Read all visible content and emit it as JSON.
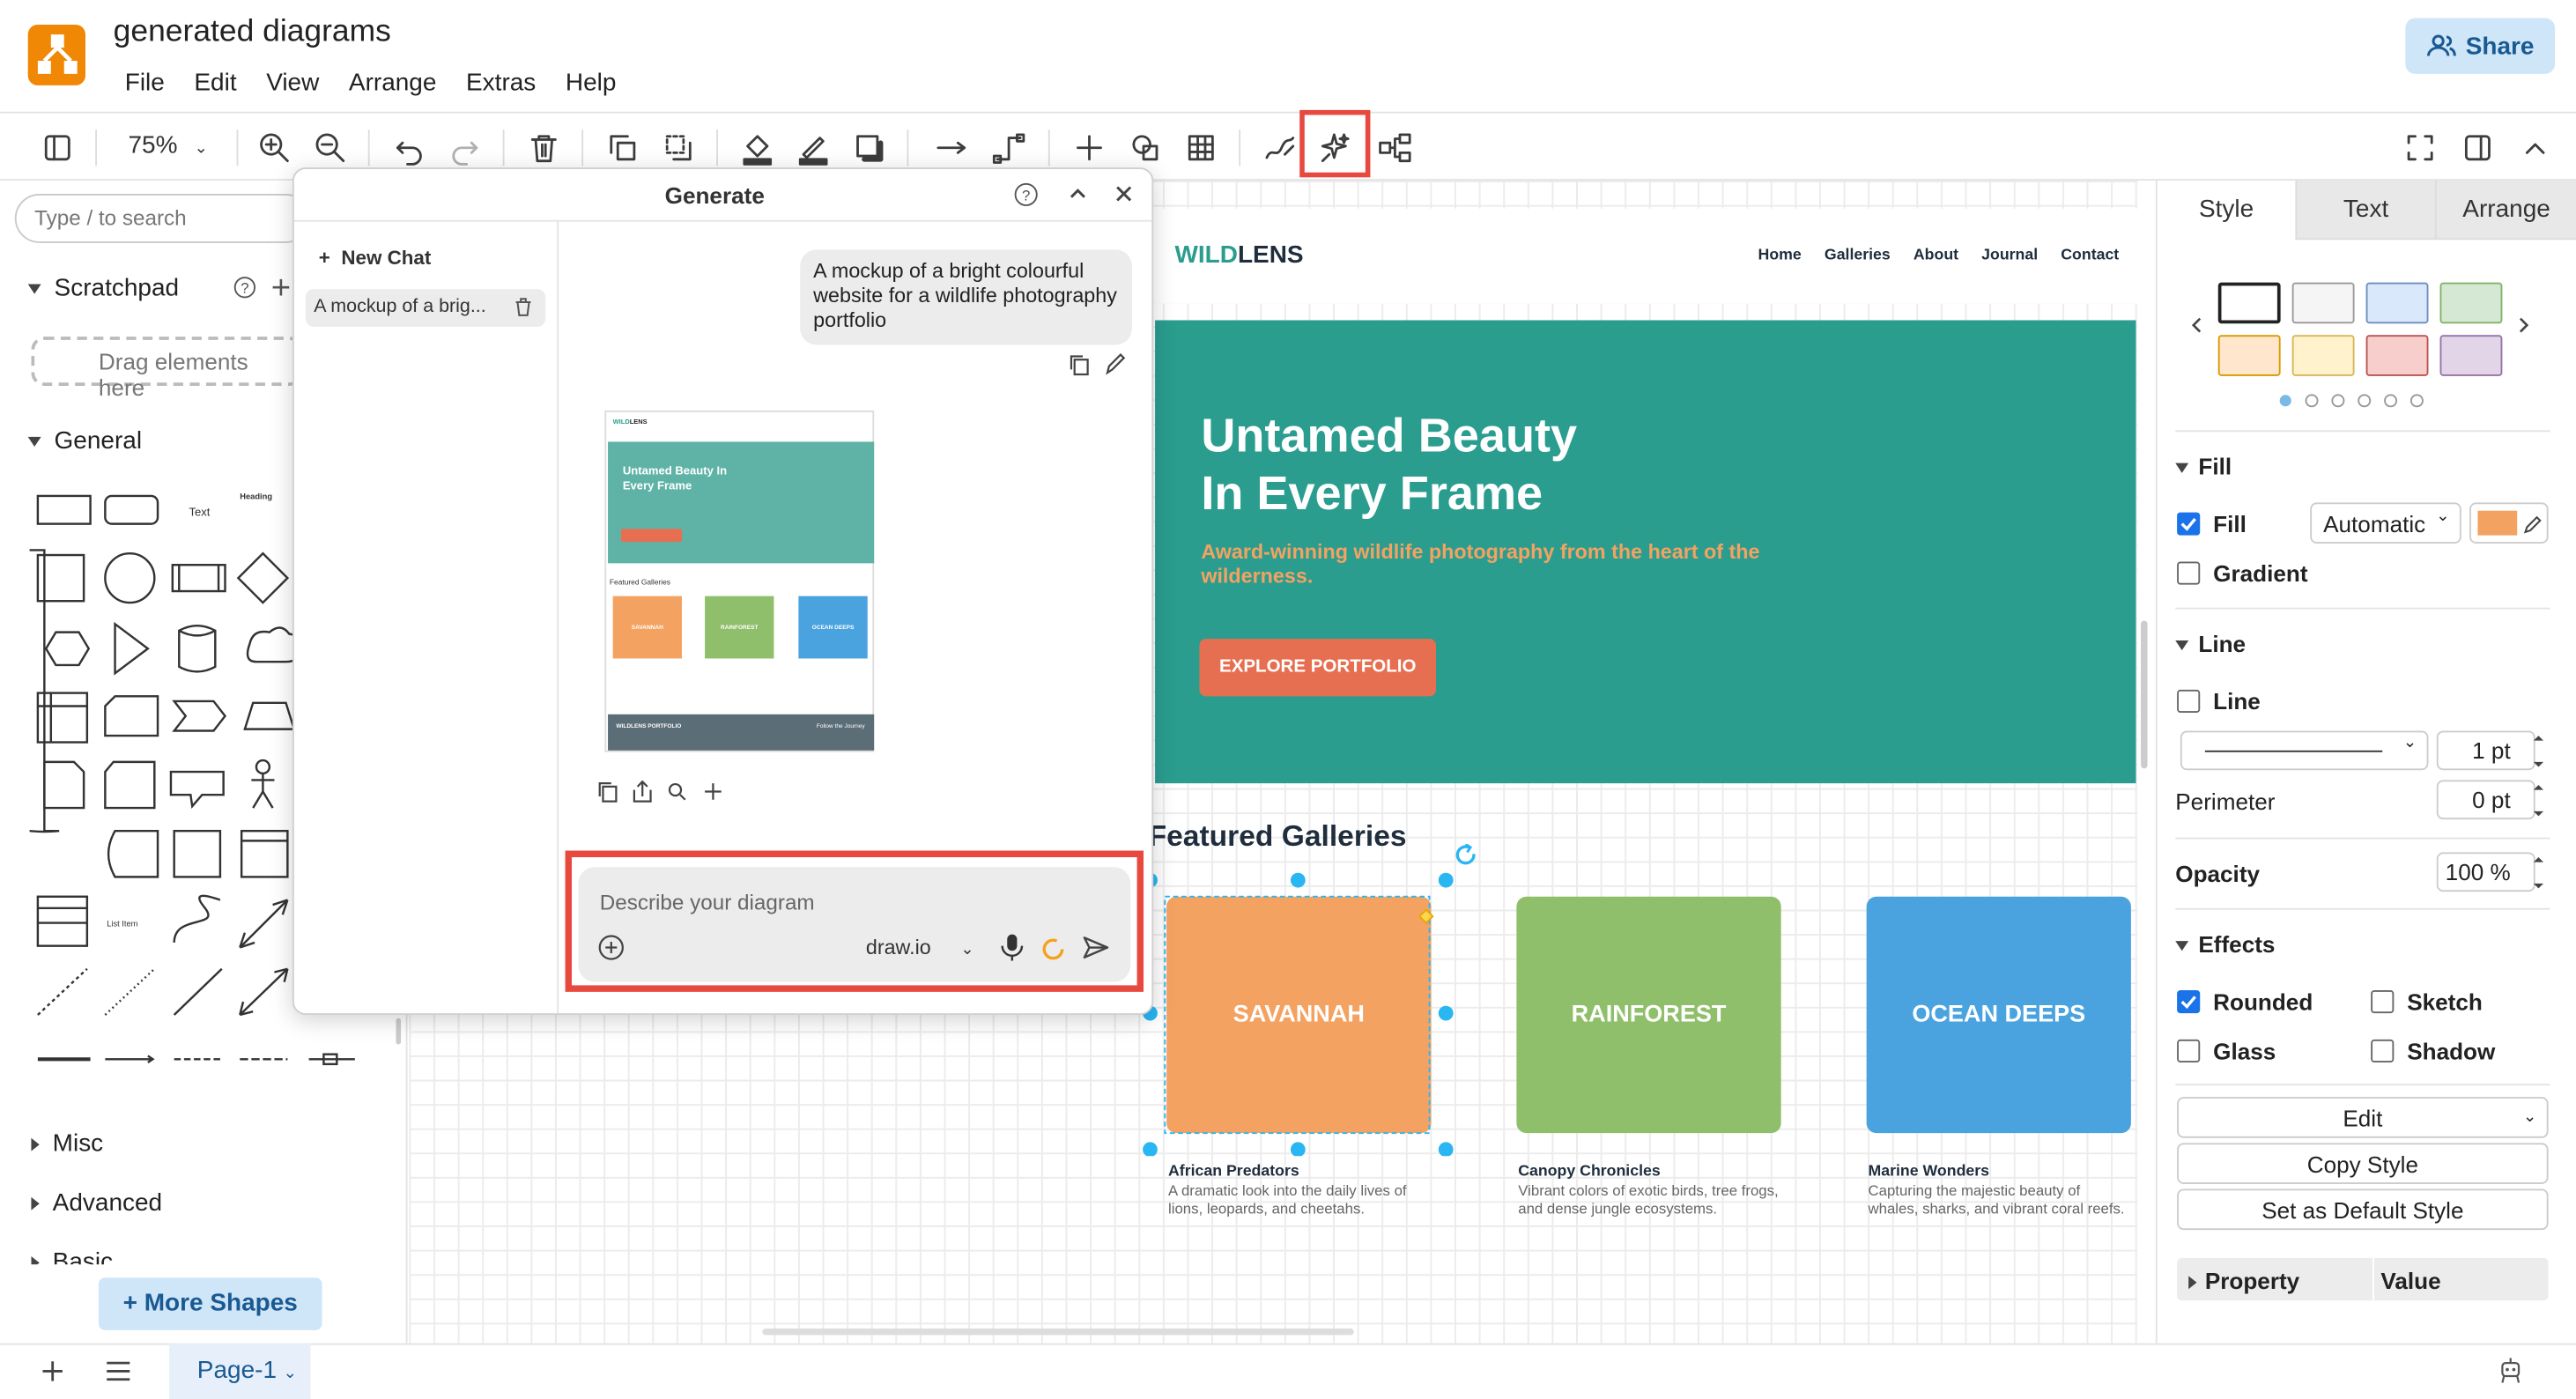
{
  "app": {
    "title": "generated diagrams",
    "menu": [
      "File",
      "Edit",
      "View",
      "Arrange",
      "Extras",
      "Help"
    ],
    "share_label": "Share"
  },
  "toolbar": {
    "zoom": "75%"
  },
  "left": {
    "search_placeholder": "Type / to search",
    "scratchpad": "Scratchpad",
    "drag_hint": "Drag elements here",
    "general": "General",
    "text_shape": "Text",
    "heading_shape": "Heading",
    "list_item_shape": "List Item",
    "misc": "Misc",
    "advanced": "Advanced",
    "basic": "Basic",
    "more_shapes": "More Shapes"
  },
  "generate": {
    "title": "Generate",
    "new_chat": "New Chat",
    "history": [
      "A mockup of a brig..."
    ],
    "user_message": "A mockup of a bright colourful website for a wildlife photography portfolio",
    "input_placeholder": "Describe your diagram",
    "model": "draw.io",
    "thumb": {
      "brand_a": "WILD",
      "brand_b": "LENS",
      "hero": "Untamed Beauty In Every Frame",
      "galleries": "Featured Galleries",
      "card_a": "SAVANNAH",
      "card_b": "RAINFOREST",
      "card_c": "OCEAN DEEPS",
      "footer": "WILDLENS PORTFOLIO",
      "footer_right": "Follow the Journey"
    }
  },
  "site": {
    "brand_a": "WILD",
    "brand_b": "LENS",
    "nav": [
      "Home",
      "Galleries",
      "About",
      "Journal",
      "Contact"
    ],
    "hero_line1": "Untamed Beauty",
    "hero_line2": "In Every Frame",
    "hero_sub": "Award-winning wildlife photography from the heart of the wilderness.",
    "cta": "EXPLORE PORTFOLIO",
    "galleries_heading": "Featured Galleries",
    "cards": [
      {
        "name": "SAVANNAH",
        "title": "African Predators",
        "desc": "A dramatic look into the daily lives of lions, leopards, and cheetahs.",
        "color": "#f4a261"
      },
      {
        "name": "RAINFOREST",
        "title": "Canopy Chronicles",
        "desc": "Vibrant colors of exotic birds, tree frogs, and dense jungle ecosystems.",
        "color": "#8fbf6a"
      },
      {
        "name": "OCEAN DEEPS",
        "title": "Marine Wonders",
        "desc": "Capturing the majestic beauty of whales, sharks, and vibrant coral reefs.",
        "color": "#4aa3df"
      }
    ],
    "colors": {
      "teal": "#2a9d8f",
      "orange": "#e76f51",
      "gold": "#f4a261"
    }
  },
  "format": {
    "tabs": [
      "Style",
      "Text",
      "Arrange"
    ],
    "fill_section": "Fill",
    "fill_label": "Fill",
    "fill_mode": "Automatic",
    "fill_color": "#f4a261",
    "gradient": "Gradient",
    "line_section": "Line",
    "line_label": "Line",
    "line_width": "1 pt",
    "perimeter": "Perimeter",
    "perimeter_value": "0 pt",
    "opacity": "Opacity",
    "opacity_value": "100 %",
    "effects": "Effects",
    "rounded": "Rounded",
    "sketch": "Sketch",
    "glass": "Glass",
    "shadow": "Shadow",
    "edit": "Edit",
    "copy_style": "Copy Style",
    "default_style": "Set as Default Style",
    "property": "Property",
    "value": "Value"
  },
  "bottom": {
    "page": "Page-1"
  }
}
